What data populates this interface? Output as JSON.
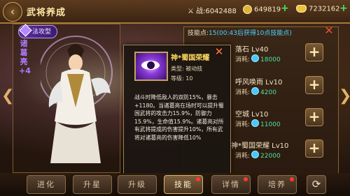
{
  "header": {
    "title": "武将养成",
    "resources": [
      {
        "icon": "stamina-icon",
        "label": "战:",
        "value": "6042488"
      },
      {
        "icon": "gold-coin-icon",
        "value": "649819"
      },
      {
        "icon": "ingot-icon",
        "value": "7232162"
      }
    ]
  },
  "general": {
    "badge": "法攻型",
    "name_vertical": "诸葛亮+4"
  },
  "skills": {
    "header_prefix": "技能点:",
    "points": "15",
    "timer": "(00:43后获得10点技能点)",
    "cost_label": "消耗:",
    "rows": [
      {
        "name": "落石 Lv40",
        "cost": "18000"
      },
      {
        "name": "呼风唤雨 Lv10",
        "cost": "4200"
      },
      {
        "name": "空城 Lv10",
        "cost": "11000"
      },
      {
        "name": "神*蜀国荣耀 Lv10",
        "cost": "22000"
      }
    ]
  },
  "popup": {
    "name": "神*蜀国荣耀",
    "type_label": "类型: 被动技",
    "level_label": "等级: 10",
    "description": "战斗时降低敌人的双防15%，暴击+1180。当诸葛亮在场时可以提升蜀国武将的攻击力15.9%，防御力15.9%，生命值15.9%。诸葛亮对所有武将提成的伤害提升10%，所有武将对诸葛亮的伤害降低10%"
  },
  "tabs": [
    {
      "label": "进化",
      "active": false,
      "dot": false
    },
    {
      "label": "升星",
      "active": false,
      "dot": false
    },
    {
      "label": "升级",
      "active": false,
      "dot": false
    },
    {
      "label": "技能",
      "active": true,
      "dot": true
    },
    {
      "label": "详情",
      "active": false,
      "dot": true
    },
    {
      "label": "培养",
      "active": false,
      "dot": true
    }
  ],
  "colors": {
    "accent": "#d9a54f",
    "skill_cost": "#50e0a0",
    "name_purple": "#b07cff"
  }
}
